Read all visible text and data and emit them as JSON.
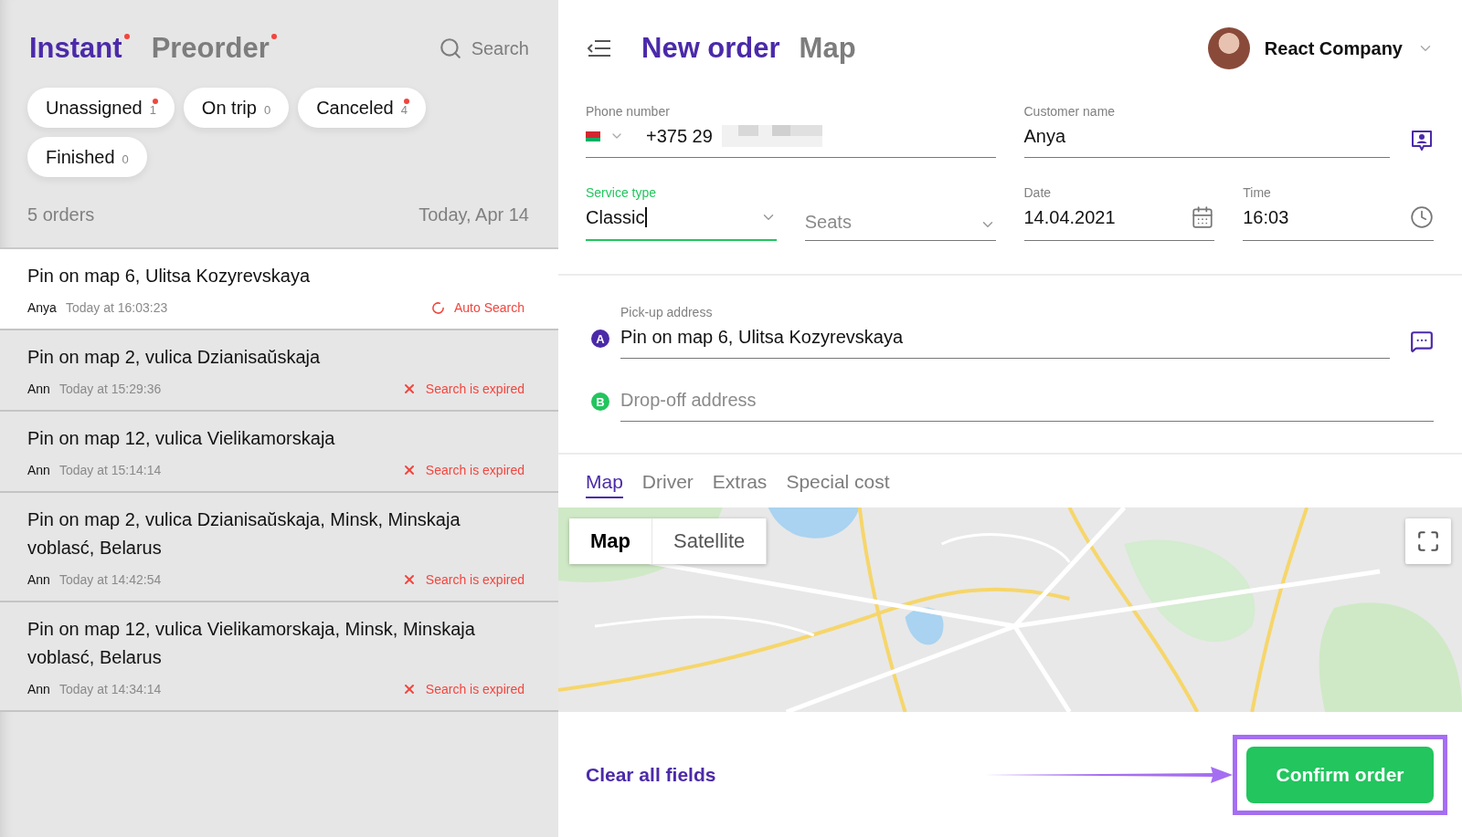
{
  "orders_panel": {
    "tabs": [
      {
        "label": "Instant",
        "selected": true,
        "alert": true
      },
      {
        "label": "Preorder",
        "selected": false,
        "alert": true
      }
    ],
    "search": {
      "placeholder": "Search"
    },
    "filters": [
      {
        "label": "Unassigned",
        "count": "1",
        "alert": true
      },
      {
        "label": "On trip",
        "count": "0",
        "alert": false
      },
      {
        "label": "Canceled",
        "count": "4",
        "alert": true
      },
      {
        "label": "Finished",
        "count": "0",
        "alert": false
      }
    ],
    "summary": {
      "count": "5 orders",
      "date": "Today, Apr 14"
    },
    "orders": [
      {
        "address": "Pin on map 6, Ulitsa Kozyrevskaya",
        "customer": "Anya",
        "time": "Today at 16:03:23",
        "status": "Auto Search",
        "kind": "searching",
        "selected": true
      },
      {
        "address": "Pin on map 2, vulica Dzianisaŭskaja",
        "customer": "Ann",
        "time": "Today at 15:29:36",
        "status": "Search is expired",
        "kind": "expired",
        "selected": false
      },
      {
        "address": "Pin on map 12, vulica Vielikamorskaja",
        "customer": "Ann",
        "time": "Today at 15:14:14",
        "status": "Search is expired",
        "kind": "expired",
        "selected": false
      },
      {
        "address": "Pin on map 2, vulica Dzianisaŭskaja, Minsk, Minskaja voblasć, Belarus",
        "customer": "Ann",
        "time": "Today at 14:42:54",
        "status": "Search is expired",
        "kind": "expired",
        "selected": false
      },
      {
        "address": "Pin on map 12, vulica Vielikamorskaja, Minsk, Minskaja voblasć, Belarus",
        "customer": "Ann",
        "time": "Today at 14:34:14",
        "status": "Search is expired",
        "kind": "expired",
        "selected": false
      }
    ]
  },
  "order_form": {
    "header": {
      "title": "New order",
      "secondary": "Map",
      "company": "React Company"
    },
    "phone": {
      "label": "Phone number",
      "value": "+375 29",
      "blurred": true
    },
    "customer": {
      "label": "Customer name",
      "value": "Anya"
    },
    "service_type": {
      "label": "Service type",
      "value": "Classic",
      "focused": true
    },
    "seats": {
      "placeholder": "Seats"
    },
    "date": {
      "label": "Date",
      "value": "14.04.2021"
    },
    "time": {
      "label": "Time",
      "value": "16:03"
    },
    "pickup": {
      "marker": "A",
      "label": "Pick-up address",
      "value": "Pin on map 6, Ulitsa Kozyrevskaya"
    },
    "dropoff": {
      "marker": "B",
      "placeholder": "Drop-off address"
    },
    "tabs": [
      {
        "label": "Map",
        "selected": true
      },
      {
        "label": "Driver",
        "selected": false
      },
      {
        "label": "Extras",
        "selected": false
      },
      {
        "label": "Special cost",
        "selected": false
      }
    ],
    "map": {
      "kind": "picture",
      "types": [
        {
          "label": "Map",
          "selected": true
        },
        {
          "label": "Satellite",
          "selected": false
        }
      ]
    },
    "clear_link": "Clear all fields",
    "confirm_button": {
      "label": "Confirm order",
      "highlighted": true
    }
  }
}
